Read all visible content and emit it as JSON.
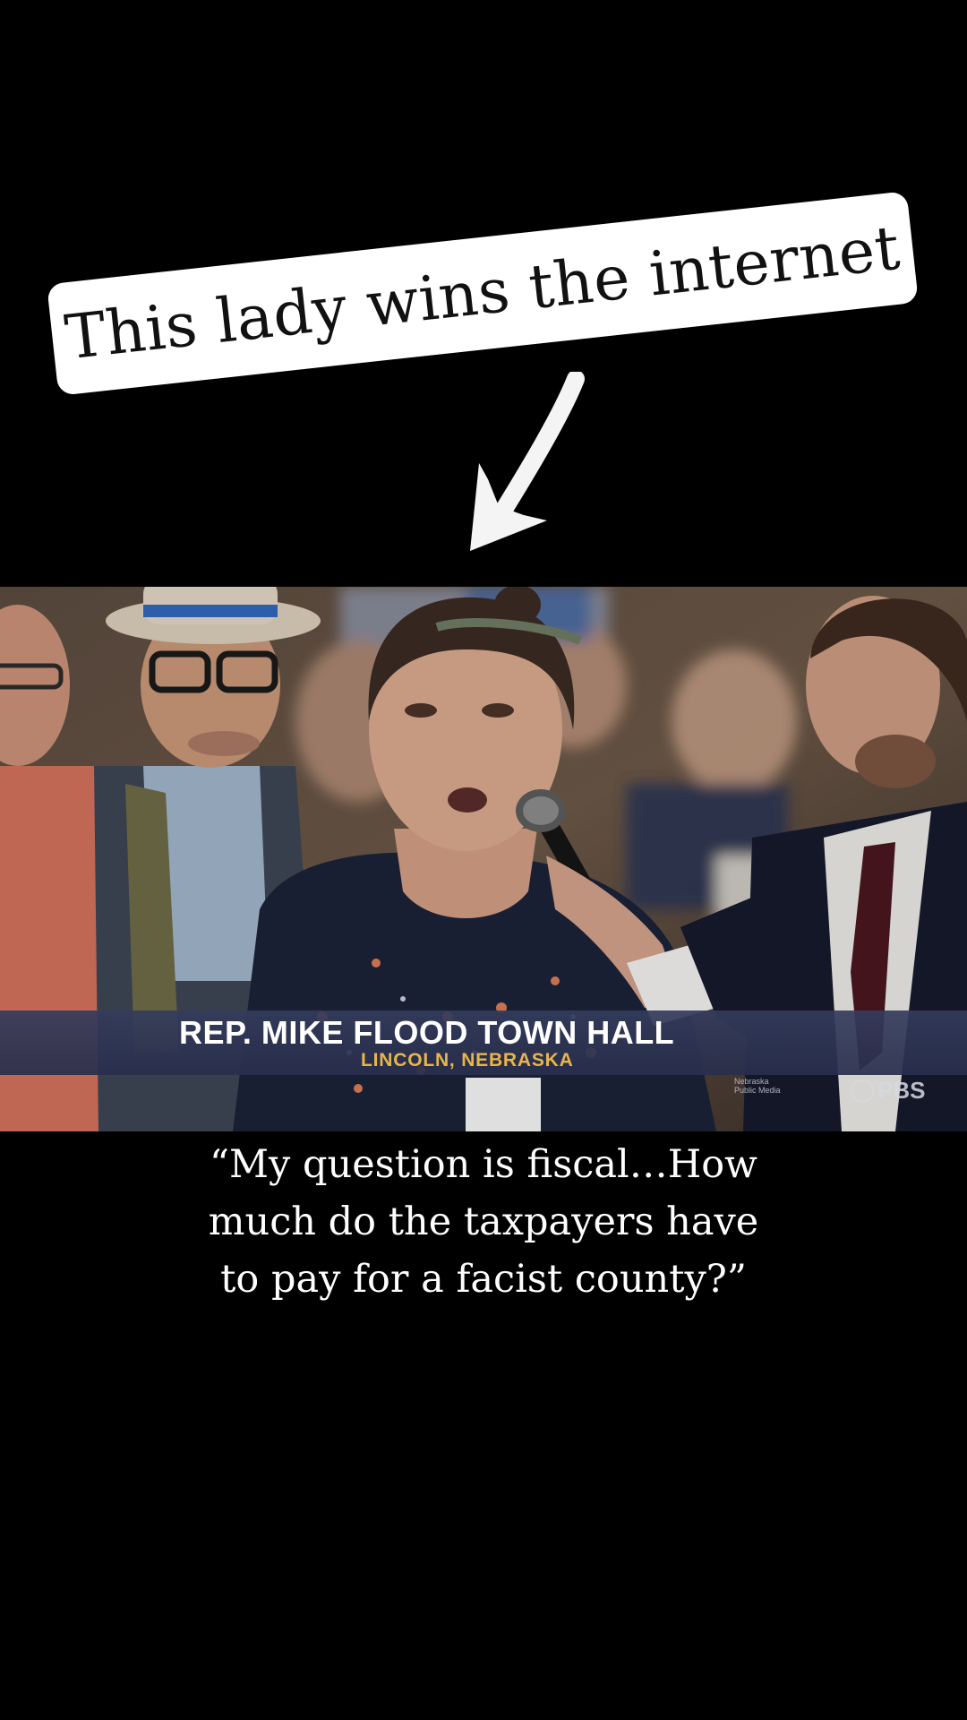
{
  "headline": {
    "text": "This lady wins the internet"
  },
  "video": {
    "lower_third": {
      "title": "REP. MIKE FLOOD TOWN HALL",
      "subtitle": "LINCOLN, NEBRASKA",
      "network_line1": "Nebraska",
      "network_line2": "Public Media",
      "broadcaster": "PBS"
    }
  },
  "caption": {
    "line1": "“My question is fiscal…How",
    "line2": "much do the taxpayers have",
    "line3": "to pay for a facist county?”"
  },
  "colors": {
    "background": "#000000",
    "sticker": "#ffffff",
    "lower_third_title": "#ffffff",
    "lower_third_subtitle": "#e8b54a",
    "caption": "#ffffff"
  },
  "icons": [
    "arrow-down-left-icon",
    "pbs-logo-icon"
  ]
}
